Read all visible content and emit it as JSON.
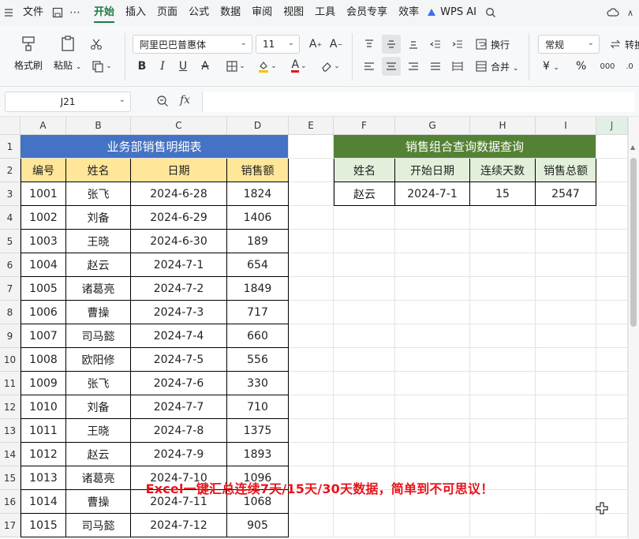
{
  "menubar": {
    "menu_icon": "hamburger-icon",
    "items": [
      "文件",
      "开始",
      "插入",
      "页面",
      "公式",
      "数据",
      "审阅",
      "视图",
      "工具",
      "会员专享",
      "效率"
    ],
    "active": "开始",
    "ai_label": "WPS AI"
  },
  "toolbar": {
    "format_painter": "格式刷",
    "paste": "粘贴",
    "font_name": "阿里巴巴普惠体",
    "font_size": "11",
    "wrap_text": "换行",
    "merge": "合并",
    "number_format": "常规",
    "convert": "转换",
    "currency_symbol": "¥",
    "percent_symbol": "%"
  },
  "formula_bar": {
    "name_box": "J21",
    "fx": "fx",
    "value": ""
  },
  "columns": [
    "A",
    "B",
    "C",
    "D",
    "E",
    "F",
    "G",
    "H",
    "I",
    "J"
  ],
  "rows": [
    "1",
    "2",
    "3",
    "4",
    "5",
    "6",
    "7",
    "8",
    "9",
    "10",
    "11",
    "12",
    "13",
    "14",
    "15",
    "16",
    "17"
  ],
  "detail_table": {
    "title": "业务部销售明细表",
    "headers": [
      "编号",
      "姓名",
      "日期",
      "销售额"
    ],
    "rows": [
      [
        "1001",
        "张飞",
        "2024-6-28",
        "1824"
      ],
      [
        "1002",
        "刘备",
        "2024-6-29",
        "1406"
      ],
      [
        "1003",
        "王晓",
        "2024-6-30",
        "189"
      ],
      [
        "1004",
        "赵云",
        "2024-7-1",
        "654"
      ],
      [
        "1005",
        "诸葛亮",
        "2024-7-2",
        "1849"
      ],
      [
        "1006",
        "曹操",
        "2024-7-3",
        "717"
      ],
      [
        "1007",
        "司马懿",
        "2024-7-4",
        "660"
      ],
      [
        "1008",
        "欧阳修",
        "2024-7-5",
        "556"
      ],
      [
        "1009",
        "张飞",
        "2024-7-6",
        "330"
      ],
      [
        "1010",
        "刘备",
        "2024-7-7",
        "710"
      ],
      [
        "1011",
        "王晓",
        "2024-7-8",
        "1375"
      ],
      [
        "1012",
        "赵云",
        "2024-7-9",
        "1893"
      ],
      [
        "1013",
        "诸葛亮",
        "2024-7-10",
        "1096"
      ],
      [
        "1014",
        "曹操",
        "2024-7-11",
        "1068"
      ],
      [
        "1015",
        "司马懿",
        "2024-7-12",
        "905"
      ]
    ]
  },
  "query_table": {
    "title": "销售组合查询数据查询",
    "headers": [
      "姓名",
      "开始日期",
      "连续天数",
      "销售总额"
    ],
    "row": [
      "赵云",
      "2024-7-1",
      "15",
      "2547"
    ]
  },
  "overlay_caption": "Excel一键汇总连续7天/15天/30天数据，简单到不可思议！",
  "colors": {
    "detail_title_bg": "#4472c4",
    "detail_header_bg": "#ffe699",
    "query_title_bg": "#548235",
    "query_header_bg": "#e2efda",
    "caption": "#e8141b",
    "accent": "#1f7a44"
  }
}
